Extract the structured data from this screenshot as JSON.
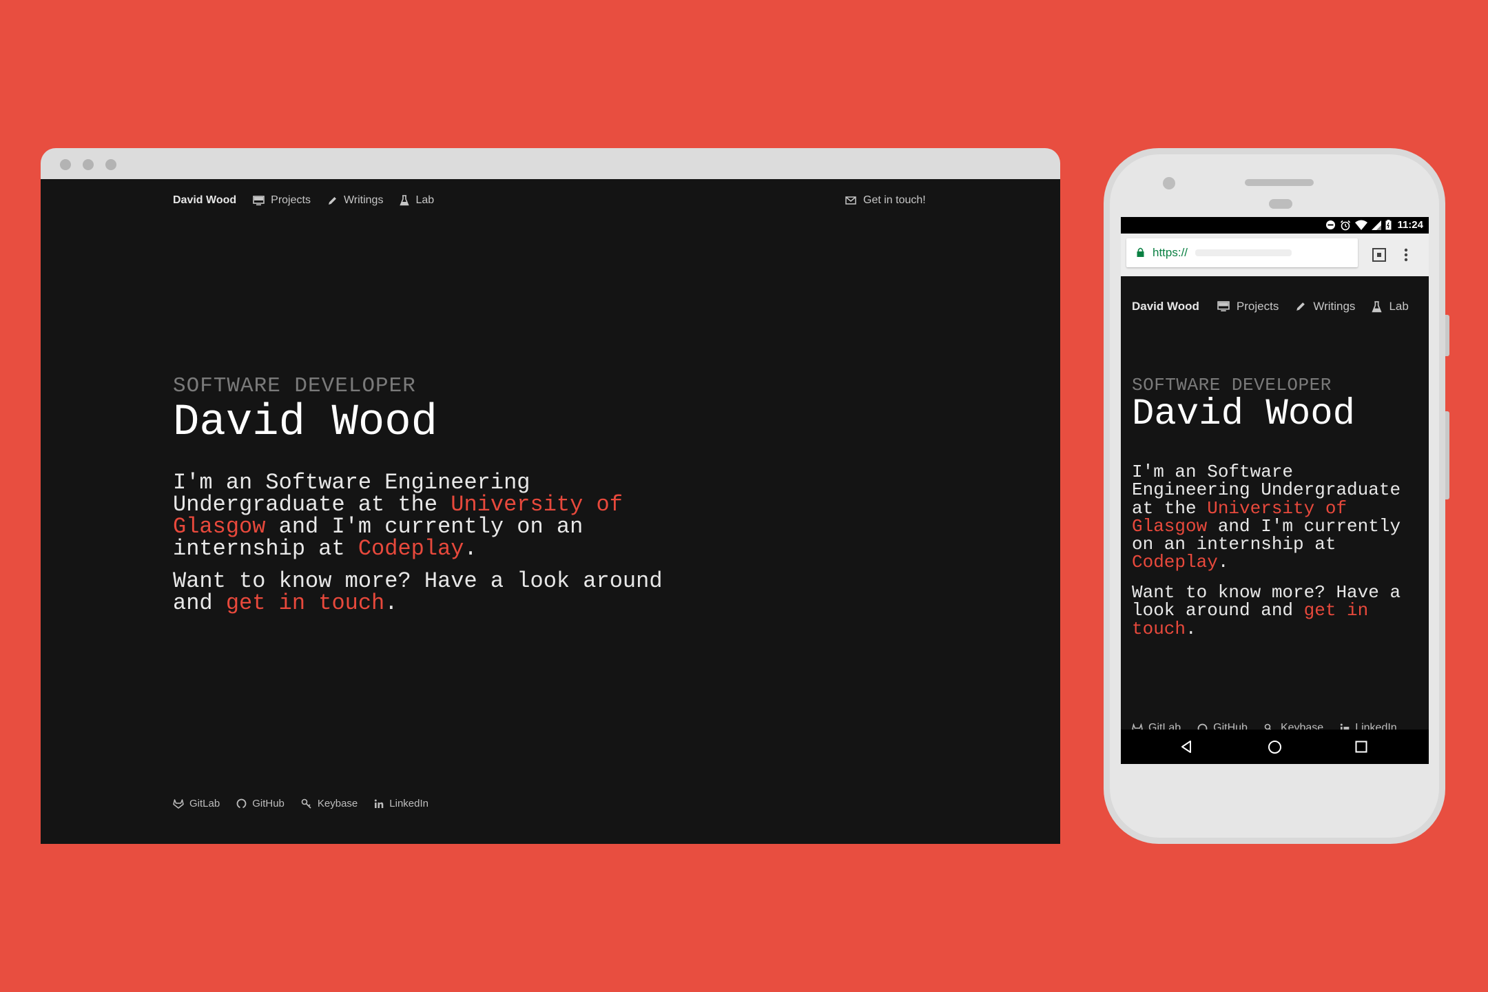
{
  "desktop": {
    "nav": {
      "brand": "David Wood",
      "items": [
        {
          "label": "Projects",
          "icon": "monitor-icon"
        },
        {
          "label": "Writings",
          "icon": "pencil-icon"
        },
        {
          "label": "Lab",
          "icon": "flask-icon"
        }
      ],
      "contact": {
        "label": "Get in touch!",
        "icon": "envelope-icon"
      }
    },
    "hero": {
      "subtitle": "SOFTWARE DEVELOPER",
      "name": "David Wood",
      "para1": {
        "t1": "I'm an Software Engineering Undergraduate at the ",
        "link1": "University of Glasgow",
        "t2": " and I'm currently on an internship at ",
        "link2": "Codeplay",
        "t3": "."
      },
      "para2": {
        "t1": "Want to know more? Have a look around and ",
        "link": "get in touch",
        "t2": "."
      }
    },
    "footer": [
      {
        "label": "GitLab",
        "icon": "gitlab-icon"
      },
      {
        "label": "GitHub",
        "icon": "github-icon"
      },
      {
        "label": "Keybase",
        "icon": "key-icon"
      },
      {
        "label": "LinkedIn",
        "icon": "linkedin-icon"
      }
    ]
  },
  "mobile": {
    "status_bar": {
      "time": "11:24"
    },
    "url_bar": {
      "url": "https://"
    },
    "nav": {
      "brand": "David Wood",
      "items": [
        {
          "label": "Projects"
        },
        {
          "label": "Writings"
        },
        {
          "label": "Lab"
        }
      ]
    },
    "hero": {
      "subtitle": "SOFTWARE DEVELOPER",
      "name": "David Wood",
      "para1": {
        "t1": "I'm an Software Engineering Undergraduate at the ",
        "link1": "University of Glasgow",
        "t2": " and I'm currently on an internship at ",
        "link2": "Codeplay",
        "t3": "."
      },
      "para2": {
        "t1": "Want to know more? Have a look around and ",
        "link": "get in touch",
        "t2": "."
      }
    },
    "footer": [
      {
        "label": "GitLab"
      },
      {
        "label": "GitHub"
      },
      {
        "label": "Keybase"
      },
      {
        "label": "LinkedIn"
      }
    ]
  },
  "colors": {
    "background": "#e84e40",
    "page": "#141414",
    "link": "#e8493c"
  }
}
